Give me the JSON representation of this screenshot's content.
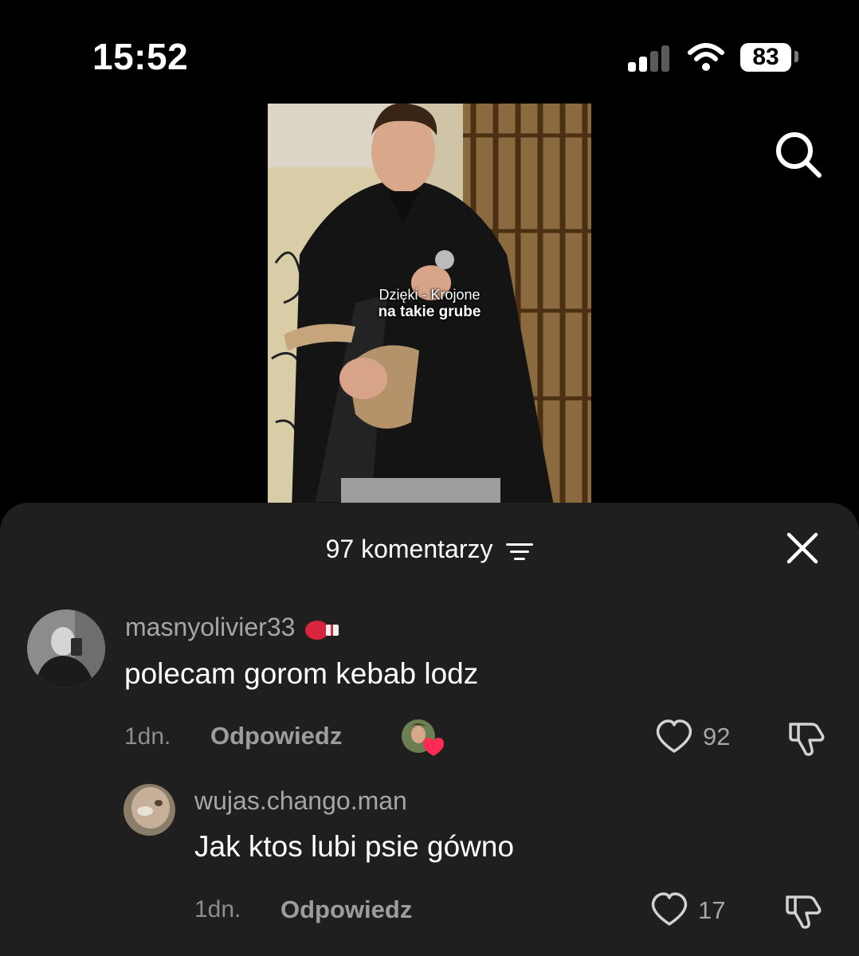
{
  "status_bar": {
    "time": "15:52",
    "battery": "83",
    "icons": [
      "signal-icon",
      "wifi-icon",
      "battery-icon"
    ]
  },
  "header": {
    "search_icon": "search-icon"
  },
  "video": {
    "caption_line1": "Dzięki - Krojone",
    "caption_line2": "na takie grube"
  },
  "comments_sheet": {
    "title": "97 komentarzy",
    "filter_icon": "filter-icon",
    "close_icon": "close-icon",
    "comments": [
      {
        "username": "masnyolivier33",
        "badge_icon": "boxing-glove-icon",
        "text": "polecam gorom kebab lodz",
        "age": "1dn.",
        "reply_label": "Odpowiedz",
        "creator_liked_icon": "heart-badge-icon",
        "likes": "92"
      },
      {
        "username": "wujas.chango.man",
        "text": "Jak ktos lubi psie gówno",
        "age": "1dn.",
        "reply_label": "Odpowiedz",
        "likes": "17"
      }
    ]
  },
  "colors": {
    "sheet_bg": "#1f1f1f",
    "text_secondary": "#a6a6a6",
    "accent_heart": "#fe2c55"
  }
}
